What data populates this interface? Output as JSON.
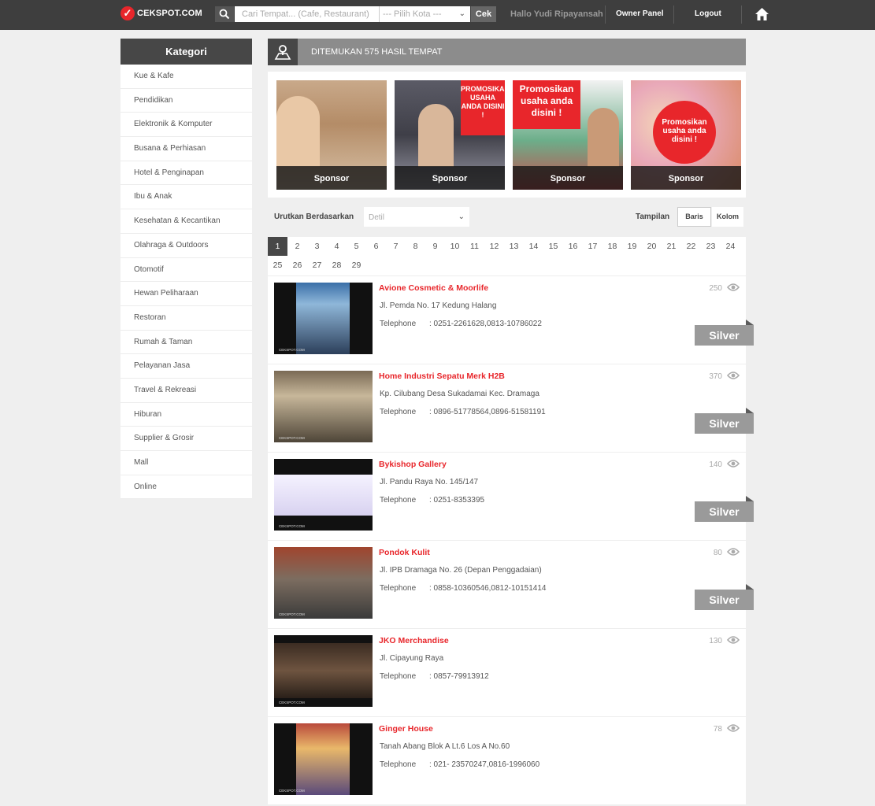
{
  "header": {
    "logo_mark": "✓",
    "logo_text": "CEKSPOT.COM",
    "search_placeholder": "Cari Tempat... (Cafe, Restaurant)",
    "city_placeholder": "--- Pilih Kota ---",
    "submit_label": "Cek",
    "greeting": "Hallo Yudi Ripayansah",
    "owner_panel": "Owner Panel",
    "logout": "Logout"
  },
  "sidebar": {
    "title": "Kategori",
    "items": [
      {
        "label": "Kue & Kafe"
      },
      {
        "label": "Pendidikan"
      },
      {
        "label": "Elektronik & Komputer"
      },
      {
        "label": "Busana & Perhiasan"
      },
      {
        "label": "Hotel & Penginapan"
      },
      {
        "label": "Ibu & Anak"
      },
      {
        "label": "Kesehatan & Kecantikan"
      },
      {
        "label": "Olahraga & Outdoors"
      },
      {
        "label": "Otomotif"
      },
      {
        "label": "Hewan Peliharaan"
      },
      {
        "label": "Restoran"
      },
      {
        "label": "Rumah & Taman"
      },
      {
        "label": "Pelayanan Jasa"
      },
      {
        "label": "Travel & Rekreasi"
      },
      {
        "label": "Hiburan"
      },
      {
        "label": "Supplier & Grosir"
      },
      {
        "label": "Mall"
      },
      {
        "label": "Online"
      }
    ]
  },
  "results": {
    "banner_text": "DITEMUKAN 575 HASIL TEMPAT"
  },
  "sponsors": [
    {
      "caption": "Sponsor",
      "promo": ""
    },
    {
      "caption": "Sponsor",
      "promo": "PROMOSIKAN USAHA ANDA DISINI !"
    },
    {
      "caption": "Sponsor",
      "promo": "Promosikan usaha anda disini !"
    },
    {
      "caption": "Sponsor",
      "promo": "Promosikan usaha anda disini !"
    }
  ],
  "sort": {
    "label": "Urutkan Berdasarkan",
    "selected": "Detil"
  },
  "view": {
    "label": "Tampilan",
    "options": [
      "Baris",
      "Kolom"
    ],
    "active": "Baris"
  },
  "pagination": {
    "current": "1",
    "pages": [
      "1",
      "2",
      "3",
      "4",
      "5",
      "6",
      "7",
      "8",
      "9",
      "10",
      "11",
      "12",
      "13",
      "14",
      "15",
      "16",
      "17",
      "18",
      "19",
      "20",
      "21",
      "22",
      "23",
      "24",
      "25",
      "26",
      "27",
      "28",
      "29"
    ]
  },
  "listings": [
    {
      "name": "Avione Cosmetic & Moorlife",
      "address": "Jl. Pemda No. 17 Kedung Halang",
      "tel_label": "Telephone",
      "telephone": ": 0251-2261628,0813-10786022",
      "views": "250",
      "badge": "Silver"
    },
    {
      "name": "Home Industri Sepatu Merk H2B",
      "address": "Kp. Cilubang Desa Sukadamai Kec. Dramaga",
      "tel_label": "Telephone",
      "telephone": ": 0896-51778564,0896-51581191",
      "views": "370",
      "badge": "Silver"
    },
    {
      "name": "Bykishop Gallery",
      "address": "Jl. Pandu Raya No. 145/147",
      "tel_label": "Telephone",
      "telephone": ": 0251-8353395",
      "views": "140",
      "badge": "Silver"
    },
    {
      "name": "Pondok Kulit",
      "address": "Jl. IPB Dramaga No. 26 (Depan Penggadaian)",
      "tel_label": "Telephone",
      "telephone": ": 0858-10360546,0812-10151414",
      "views": "80",
      "badge": "Silver"
    },
    {
      "name": "JKO Merchandise",
      "address": "Jl. Cipayung Raya",
      "tel_label": "Telephone",
      "telephone": ": 0857-79913912",
      "views": "130",
      "badge": ""
    },
    {
      "name": "Ginger House",
      "address": "Tanah Abang Blok A Lt.6 Los A No.60",
      "tel_label": "Telephone",
      "telephone": ": 021- 23570247,0816-1996060",
      "views": "78",
      "badge": ""
    }
  ],
  "thumb_watermark": "CEKSPOT.COM",
  "colors": {
    "accent": "#e8262b",
    "topbar": "#3e3e3e",
    "badge": "#9a9a9a"
  }
}
